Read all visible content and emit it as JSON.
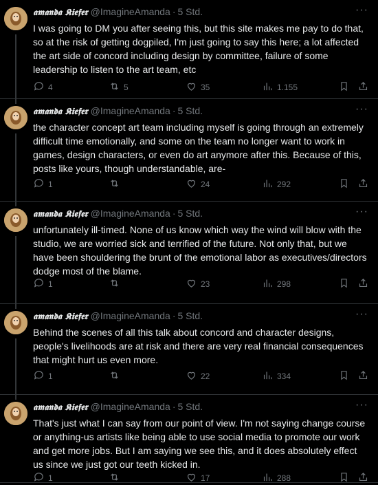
{
  "author": {
    "name": "𝖆𝖒𝖆𝖓𝖉𝖆 𝕶𝖎𝖊𝖋𝖊𝖗",
    "handle": "@ImagineAmanda",
    "time": "5 Std."
  },
  "tweets": [
    {
      "text": "I was going to DM you after seeing this, but this site makes me pay to do that, so at the risk of getting dogpiled, I'm just going to say this here; a lot affected the art side of concord including design by committee, failure of some leadership to listen to the art team, etc",
      "replies": "4",
      "reposts": "5",
      "likes": "35",
      "views": "1.155"
    },
    {
      "text": "the character concept art team including myself is going through an extremely difficult time emotionally, and some on the team no longer want to work in games, design characters, or even do art anymore after this. Because of this, posts like yours, though understandable, are-",
      "replies": "1",
      "reposts": "",
      "likes": "24",
      "views": "292"
    },
    {
      "text": "unfortunately ill-timed.  None of us know which way the wind will blow with the studio, we are worried sick and terrified of the future.  Not only that, but we have been shouldering the brunt of the emotional labor as executives/directors dodge most of the blame.",
      "replies": "1",
      "reposts": "",
      "likes": "23",
      "views": "298"
    },
    {
      "text": "Behind the scenes of all this talk about concord and character designs, people's livelihoods are at risk and there are very real financial consequences that might hurt us even more.",
      "replies": "1",
      "reposts": "",
      "likes": "22",
      "views": "334"
    },
    {
      "text": "That's just what I can say from our point of view.  I'm not saying change course or anything-us artists like being able to use social media to promote our work and get more jobs.  But I am saying we see this, and it does absolutely effect us since we just got our teeth kicked in.",
      "replies": "1",
      "reposts": "",
      "likes": "17",
      "views": "288"
    }
  ]
}
